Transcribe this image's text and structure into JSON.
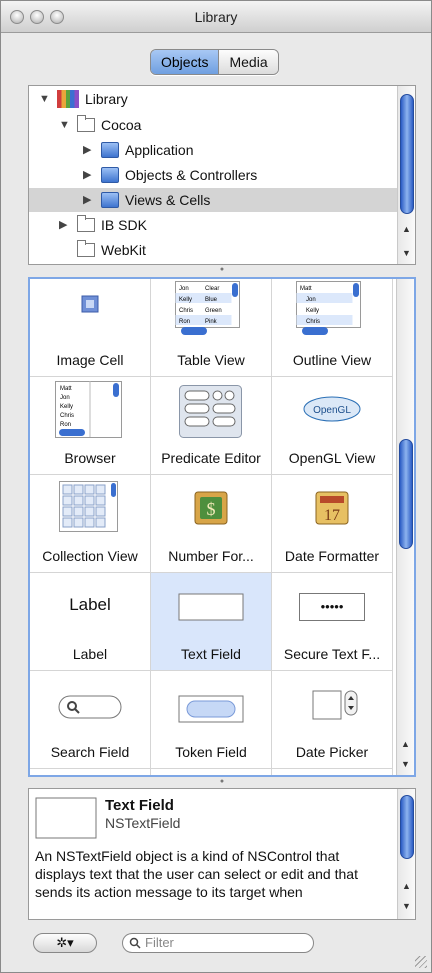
{
  "window": {
    "title": "Library"
  },
  "segmented": {
    "objects": "Objects",
    "media": "Media"
  },
  "tree": {
    "items": [
      {
        "label": "Library"
      },
      {
        "label": "Cocoa"
      },
      {
        "label": "Application"
      },
      {
        "label": "Objects & Controllers"
      },
      {
        "label": "Views & Cells"
      },
      {
        "label": "IB SDK"
      },
      {
        "label": "WebKit"
      }
    ],
    "selected": "Views & Cells"
  },
  "objects": [
    {
      "label": "Image Cell"
    },
    {
      "label": "Table View"
    },
    {
      "label": "Outline View"
    },
    {
      "label": "Browser"
    },
    {
      "label": "Predicate Editor"
    },
    {
      "label": "OpenGL View"
    },
    {
      "label": "Collection View"
    },
    {
      "label": "Number For..."
    },
    {
      "label": "Date Formatter"
    },
    {
      "label": "Label"
    },
    {
      "label": "Text Field"
    },
    {
      "label": "Secure Text F..."
    },
    {
      "label": "Search Field"
    },
    {
      "label": "Token Field"
    },
    {
      "label": "Date Picker"
    }
  ],
  "icon_text": {
    "label_preview": "Label",
    "opengl": "OpenGL",
    "secure_dots": "•••••",
    "date_day": "17",
    "table_cells": [
      "Jon",
      "Clear",
      "Kelly",
      "Blue",
      "Chris",
      "Green",
      "Ron",
      "Pink"
    ],
    "outline_cells": [
      "Matt",
      "Jon",
      "Kelly",
      "Chris"
    ],
    "browser_cells": [
      "Matt",
      "Jon",
      "Kelly",
      "Chris",
      "Ron"
    ]
  },
  "detail": {
    "title": "Text Field",
    "class": "NSTextField",
    "description": "An NSTextField object is a kind of NSControl that displays text that the user can select or edit and that sends its action message to its target when"
  },
  "bottom": {
    "filter_placeholder": "Filter",
    "action_icon": "gear-icon"
  }
}
